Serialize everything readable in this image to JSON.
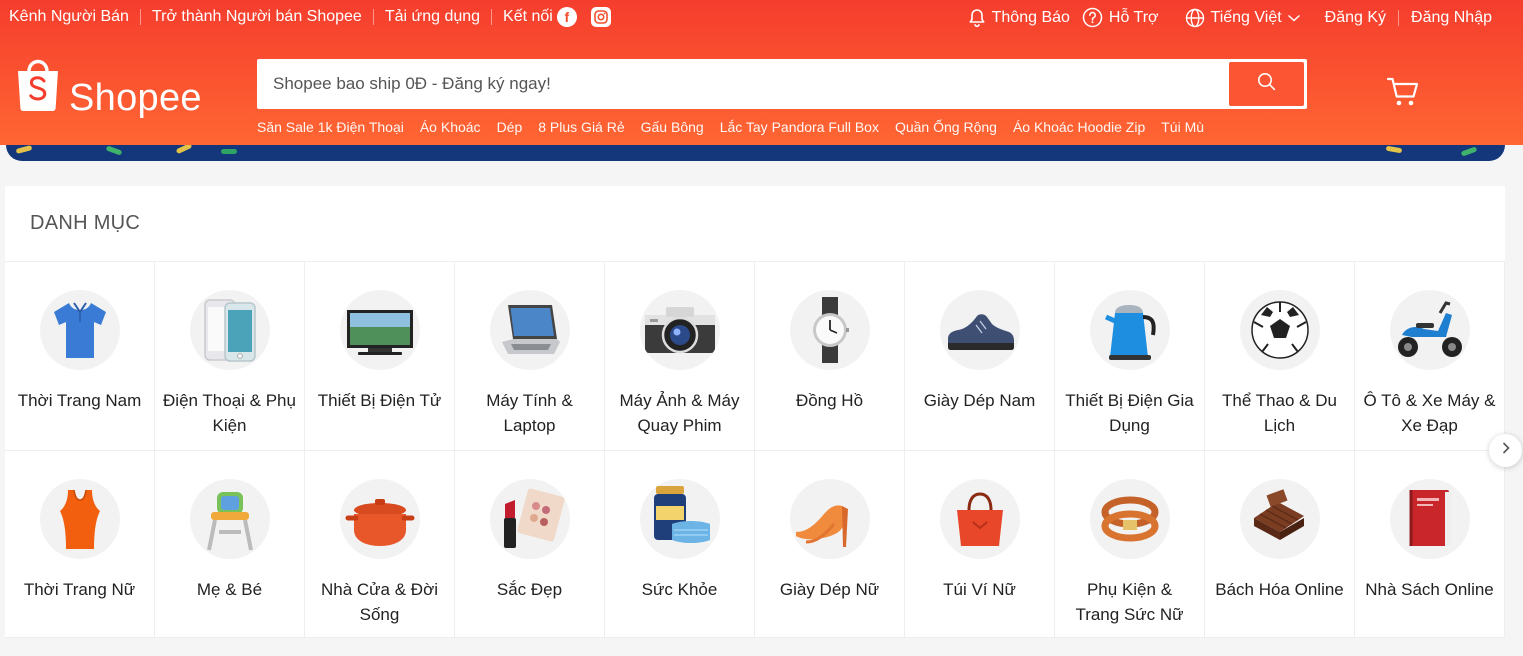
{
  "topnav": {
    "seller_centre": "Kênh Người Bán",
    "become_seller": "Trở thành Người bán Shopee",
    "download_app": "Tải ứng dụng",
    "connect": "Kết nối",
    "notifications": "Thông Báo",
    "help": "Hỗ Trợ",
    "language": "Tiếng Việt",
    "signup": "Đăng Ký",
    "login": "Đăng Nhập"
  },
  "logo": {
    "text": "Shopee"
  },
  "search": {
    "placeholder": "Shopee bao ship 0Đ - Đăng ký ngay!"
  },
  "suggestions": [
    "Săn Sale 1k Điện Thoại",
    "Áo Khoác",
    "Dép",
    "8 Plus Giá Rẻ",
    "Gấu Bông",
    "Lắc Tay Pandora Full Box",
    "Quần Ống Rộng",
    "Áo Khoác Hoodie Zip",
    "Túi Mù"
  ],
  "categories": {
    "title": "DANH MỤC",
    "row1": [
      {
        "label": "Thời Trang Nam",
        "icon": "shirt-icon"
      },
      {
        "label": "Điện Thoại & Phụ Kiện",
        "icon": "phone-icon"
      },
      {
        "label": "Thiết Bị Điện Tử",
        "icon": "tv-icon"
      },
      {
        "label": "Máy Tính & Laptop",
        "icon": "laptop-icon"
      },
      {
        "label": "Máy Ảnh & Máy Quay Phim",
        "icon": "camera-icon"
      },
      {
        "label": "Đồng Hồ",
        "icon": "watch-icon"
      },
      {
        "label": "Giày Dép Nam",
        "icon": "mens-shoe-icon"
      },
      {
        "label": "Thiết Bị Điện Gia Dụng",
        "icon": "kettle-icon"
      },
      {
        "label": "Thể Thao & Du Lịch",
        "icon": "soccer-ball-icon"
      },
      {
        "label": "Ô Tô & Xe Máy & Xe Đạp",
        "icon": "scooter-icon"
      }
    ],
    "row2": [
      {
        "label": "Thời Trang Nữ",
        "icon": "tank-top-icon"
      },
      {
        "label": "Mẹ & Bé",
        "icon": "high-chair-icon"
      },
      {
        "label": "Nhà Cửa & Đời Sống",
        "icon": "cooking-pot-icon"
      },
      {
        "label": "Sắc Đẹp",
        "icon": "makeup-icon"
      },
      {
        "label": "Sức Khỏe",
        "icon": "health-icon"
      },
      {
        "label": "Giày Dép Nữ",
        "icon": "high-heel-icon"
      },
      {
        "label": "Túi Ví Nữ",
        "icon": "handbag-icon"
      },
      {
        "label": "Phụ Kiện & Trang Sức Nữ",
        "icon": "bracelet-icon"
      },
      {
        "label": "Bách Hóa Online",
        "icon": "chocolate-icon"
      },
      {
        "label": "Nhà Sách Online",
        "icon": "book-icon"
      }
    ]
  },
  "colors": {
    "brand": "#ee4d2d",
    "search_button": "#fb5533"
  }
}
